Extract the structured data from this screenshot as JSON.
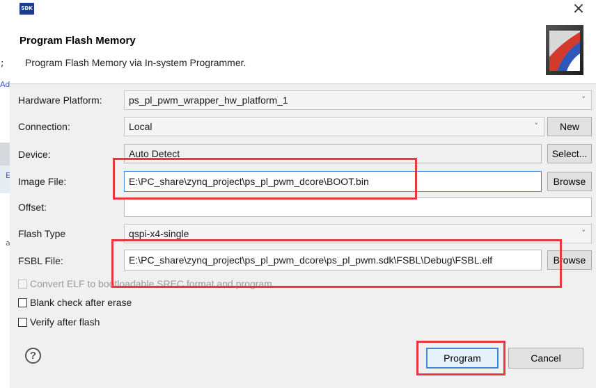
{
  "background": {
    "fragments": [
      ";",
      "Ad",
      "E",
      "a"
    ]
  },
  "window": {
    "app_icon_text": "SDK",
    "close_glyph": "×"
  },
  "header": {
    "title": "Program Flash Memory",
    "description": "Program Flash Memory via In-system Programmer."
  },
  "form": {
    "hardware_platform": {
      "label": "Hardware Platform:",
      "value": "ps_pl_pwm_wrapper_hw_platform_1"
    },
    "connection": {
      "label": "Connection:",
      "value": "Local",
      "button": "New"
    },
    "device": {
      "label": "Device:",
      "value": "Auto Detect",
      "button": "Select..."
    },
    "image_file": {
      "label": "Image File:",
      "value": "E:\\PC_share\\zynq_project\\ps_pl_pwm_dcore\\BOOT.bin",
      "button": "Browse"
    },
    "offset": {
      "label": "Offset:",
      "value": ""
    },
    "flash_type": {
      "label": "Flash Type",
      "value": "qspi-x4-single"
    },
    "fsbl_file": {
      "label": "FSBL File:",
      "value": "E:\\PC_share\\zynq_project\\ps_pl_pwm_dcore\\ps_pl_pwm.sdk\\FSBL\\Debug\\FSBL.elf",
      "button": "Browse"
    }
  },
  "options": {
    "convert_elf": {
      "label": "Convert ELF to bootloadable SREC format and program",
      "checked": false,
      "enabled": false
    },
    "blank_check": {
      "label": "Blank check after erase",
      "checked": false
    },
    "verify": {
      "label": "Verify after flash",
      "checked": false
    }
  },
  "footer": {
    "help_glyph": "?",
    "program": "Program",
    "cancel": "Cancel"
  },
  "icons": {
    "dropdown_arrow": "˅"
  },
  "colors": {
    "highlight_box": "#e8373d",
    "focus_border": "#3c8ad6"
  }
}
